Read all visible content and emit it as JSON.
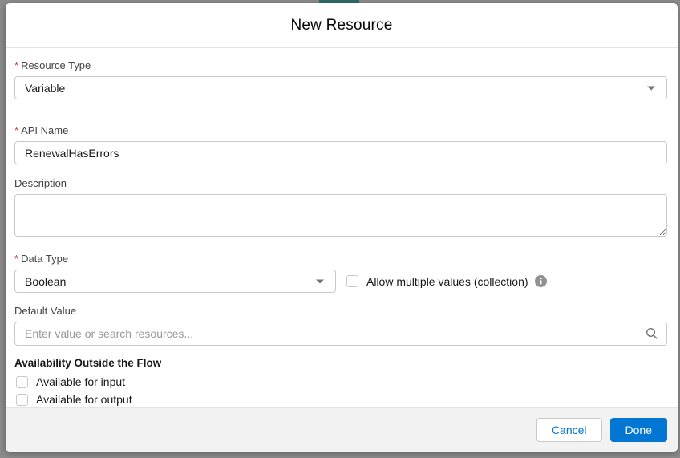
{
  "modal": {
    "title": "New Resource",
    "required_marker": "*"
  },
  "fields": {
    "resource_type": {
      "label": "Resource Type",
      "required": true,
      "value": "Variable"
    },
    "api_name": {
      "label": "API Name",
      "required": true,
      "value": "RenewalHasErrors"
    },
    "description": {
      "label": "Description",
      "value": ""
    },
    "data_type": {
      "label": "Data Type",
      "required": true,
      "value": "Boolean"
    },
    "allow_multiple": {
      "label": "Allow multiple values (collection)",
      "checked": false
    },
    "default_value": {
      "label": "Default Value",
      "placeholder": "Enter value or search resources...",
      "value": ""
    }
  },
  "availability": {
    "heading": "Availability Outside the Flow",
    "input_option": {
      "label": "Available for input",
      "checked": false
    },
    "output_option": {
      "label": "Available for output",
      "checked": false
    }
  },
  "footer": {
    "cancel_label": "Cancel",
    "done_label": "Done"
  },
  "icons": {
    "dropdown_chevron": "chevron-down-icon",
    "info": "info-icon",
    "search": "search-icon"
  },
  "colors": {
    "brand_blue": "#0176d3",
    "required_red": "#c23934",
    "canvas_gray": "#8b8b8b",
    "canvas_teal": "#2f6b66",
    "footer_gray": "#f3f2f2"
  }
}
